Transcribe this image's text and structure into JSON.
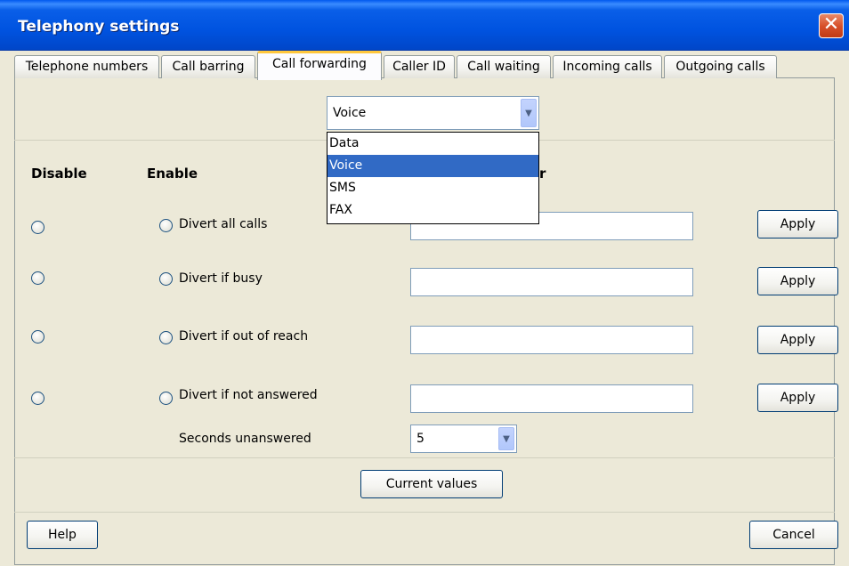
{
  "window": {
    "title": "Telephony settings",
    "close_glyph": "✕"
  },
  "tabs": [
    {
      "label": "Telephone numbers"
    },
    {
      "label": "Call barring"
    },
    {
      "label": "Call forwarding"
    },
    {
      "label": "Caller ID"
    },
    {
      "label": "Call waiting"
    },
    {
      "label": "Incoming calls"
    },
    {
      "label": "Outgoing calls"
    }
  ],
  "service_combo": {
    "selected": "Voice",
    "options": [
      "Data",
      "Voice",
      "SMS",
      "FAX"
    ],
    "highlighted": "Voice"
  },
  "headers": {
    "disable": "Disable",
    "enable": "Enable",
    "number_partial": "r"
  },
  "rows": [
    {
      "label": "Divert all calls",
      "number": "",
      "apply": "Apply"
    },
    {
      "label": "Divert if busy",
      "number": "",
      "apply": "Apply"
    },
    {
      "label": "Divert if out of reach",
      "number": "",
      "apply": "Apply"
    },
    {
      "label": "Divert if not answered",
      "number": "",
      "apply": "Apply"
    }
  ],
  "seconds": {
    "label": "Seconds unanswered",
    "value": "5"
  },
  "buttons": {
    "current_values": "Current values",
    "help": "Help",
    "cancel": "Cancel"
  },
  "colors": {
    "titlebar": "#0053E0",
    "tab_highlight": "#FFC73C",
    "selection": "#316AC5",
    "close": "#D8512B"
  }
}
